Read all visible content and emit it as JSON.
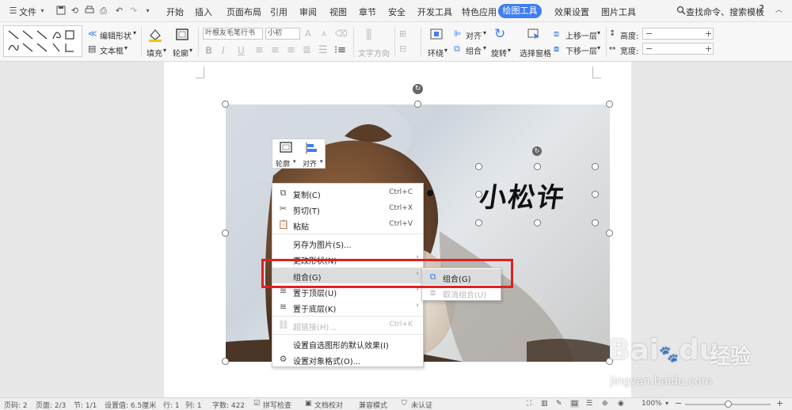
{
  "menubar": {
    "file_label": "文件",
    "tabs": [
      "开始",
      "插入",
      "页面布局",
      "引用",
      "审阅",
      "视图",
      "章节",
      "安全",
      "开发工具",
      "特色应用"
    ],
    "active_tab": "绘图工具",
    "extra_tabs": [
      "效果设置",
      "图片工具"
    ],
    "search_label": "查找命令、搜索模板",
    "help": "?"
  },
  "ribbon": {
    "edit_shape": "编辑形状",
    "text_box": "文本框",
    "fill": "填充",
    "outline": "轮廓",
    "font_name": "叶根友毛笔行书",
    "font_size": "小初",
    "text_direction": "文字方向",
    "wrap": "环绕",
    "align": "对齐",
    "group": "组合",
    "rotate": "旋转",
    "selection_pane": "选择窗格",
    "bring_forward": "上移一层",
    "send_backward": "下移一层",
    "height_label": "高度:",
    "width_label": "宽度:",
    "minus": "−",
    "plus": "+"
  },
  "document": {
    "float_outline": "轮廓",
    "float_align": "对齐",
    "calligraphy": "小松许"
  },
  "context_menu": {
    "items": [
      {
        "label": "复制(C)",
        "shortcut": "Ctrl+C",
        "icon": "copy-icon"
      },
      {
        "label": "剪切(T)",
        "shortcut": "Ctrl+X",
        "icon": "cut-icon"
      },
      {
        "label": "粘贴",
        "shortcut": "Ctrl+V",
        "icon": "paste-icon"
      },
      {
        "label": "另存为图片(S)..."
      },
      {
        "label": "更改形状(N)"
      },
      {
        "label": "组合(G)"
      },
      {
        "label": "置于顶层(U)"
      },
      {
        "label": "置于底层(K)"
      },
      {
        "label": "超链接(H)...",
        "shortcut": "Ctrl+K"
      },
      {
        "label": "设置自选图形的默认效果(I)"
      },
      {
        "label": "设置对象格式(O)..."
      }
    ],
    "submenu": [
      "组合(G)",
      "取消组合(U)"
    ]
  },
  "statusbar": {
    "page_num": "页码: 2",
    "pages": "页面: 2/3",
    "section": "节: 1/1",
    "setting": "设置值: 6.5厘米",
    "row": "行: 1",
    "col": "列: 1",
    "word_count": "字数: 422",
    "spell_check": "拼写检查",
    "doc_check": "文档校对",
    "compat": "兼容模式",
    "cert": "未认证",
    "zoom": "100%",
    "zoom_level": 0.5
  },
  "watermark": {
    "brand": "Bai",
    "brand2": "du",
    "cn": "经验",
    "url": "jingyan.baidu.com"
  }
}
